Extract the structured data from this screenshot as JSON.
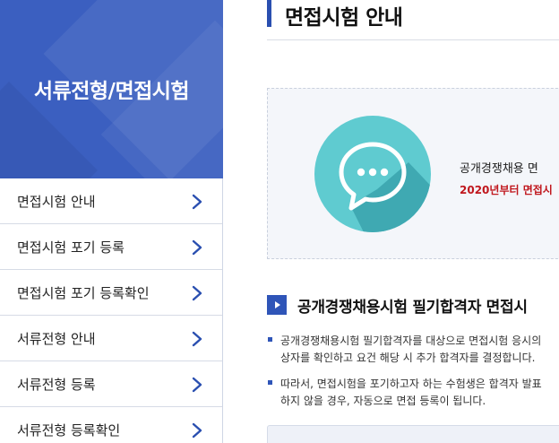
{
  "sidebar": {
    "title": "서류전형/면접시험",
    "items": [
      {
        "label": "면접시험 안내"
      },
      {
        "label": "면접시험 포기 등록"
      },
      {
        "label": "면접시험 포기 등록확인"
      },
      {
        "label": "서류전형 안내"
      },
      {
        "label": "서류전형 등록"
      },
      {
        "label": "서류전형 등록확인"
      }
    ]
  },
  "main": {
    "page_title": "면접시험 안내",
    "info": {
      "icon": "chat-bubble-icon",
      "line1": "공개경쟁채용 면",
      "line2": "2020년부터 면접시"
    },
    "section": {
      "icon": "play-arrow-icon",
      "title": "공개경쟁채용시험 필기합격자 면접시"
    },
    "paragraphs": [
      {
        "line1": "공개경쟁채용시험 필기합격자를 대상으로 면접시험 응시의",
        "line2": "상자를 확인하고 요건 해당 시 추가 합격자를 결정합니다."
      },
      {
        "line1": "따라서, 면접시험을 포기하고자 하는 수험생은 합격자 발표",
        "line2": "하지 않을 경우, 자동으로 면접 등록이 됩니다."
      }
    ]
  },
  "colors": {
    "accent": "#3b5fc0",
    "teal": "#5fcbd0",
    "warning": "#c0171d"
  }
}
